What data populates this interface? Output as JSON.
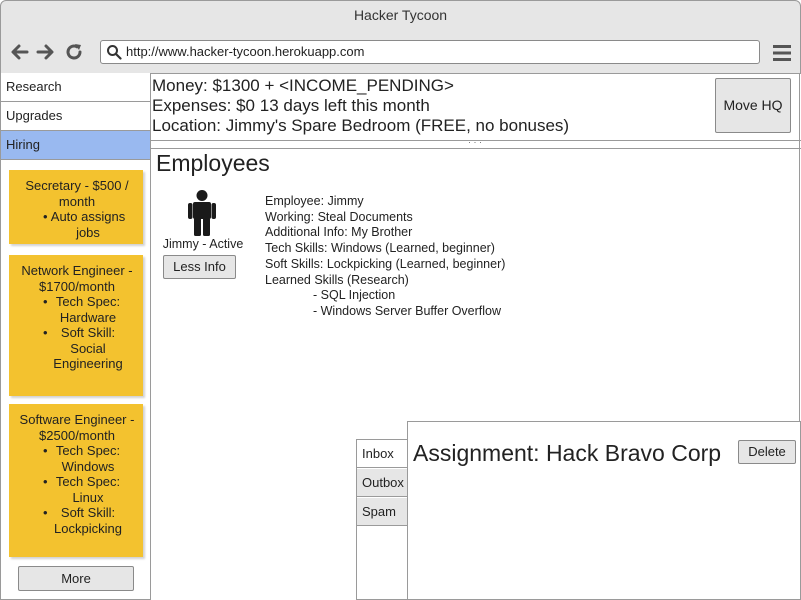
{
  "window": {
    "title": "Hacker Tycoon"
  },
  "browser": {
    "url": "http://www.hacker-tycoon.herokuapp.com",
    "icons": [
      "back-arrow-icon",
      "forward-arrow-icon",
      "reload-icon",
      "search-icon",
      "hamburger-menu-icon"
    ]
  },
  "sidebar": {
    "nav": [
      {
        "label": "Research"
      },
      {
        "label": "Upgrades"
      },
      {
        "label": "Hiring",
        "active": true
      }
    ],
    "cards": [
      {
        "title": "Secretary - $500 / month",
        "bullets": [
          "Auto assigns jobs"
        ]
      },
      {
        "title": "Network Engineer - $1700/month",
        "bullets": [
          "Tech Spec: Hardware",
          "Soft Skill: Social Engineering"
        ]
      },
      {
        "title": "Software Engineer - $2500/month",
        "bullets": [
          "Tech Spec: Windows",
          "Tech Spec: Linux",
          "Soft Skill: Lockpicking"
        ]
      }
    ],
    "more_label": "More",
    "card_color": "#f3c22f",
    "active_color": "#99b9f0"
  },
  "stats": {
    "money": "Money: $1300 + <INCOME_PENDING>",
    "expenses": "Expenses: $0   13 days left this month",
    "location": "Location: Jimmy's Spare Bedroom (FREE, no bonuses)"
  },
  "move_hq_label": "Move HQ",
  "divider_handle": "· · ·",
  "employees": {
    "title": "Employees",
    "caption": "Jimmy - Active",
    "less_info_label": "Less Info",
    "details": [
      "Employee: Jimmy",
      "Working: Steal Documents",
      "Additional Info: My Brother",
      "Tech Skills: Windows (Learned, beginner)",
      "Soft Skills: Lockpicking (Learned, beginner)",
      "Learned Skills (Research)"
    ],
    "learned": [
      "- SQL Injection",
      "- Windows Server Buffer Overflow"
    ]
  },
  "mail": {
    "tabs": [
      {
        "label": "Inbox",
        "selected": true
      },
      {
        "label": "Outbox"
      },
      {
        "label": "Spam"
      }
    ],
    "assignment_title": "Assignment: Hack Bravo Corp",
    "delete_label": "Delete"
  }
}
